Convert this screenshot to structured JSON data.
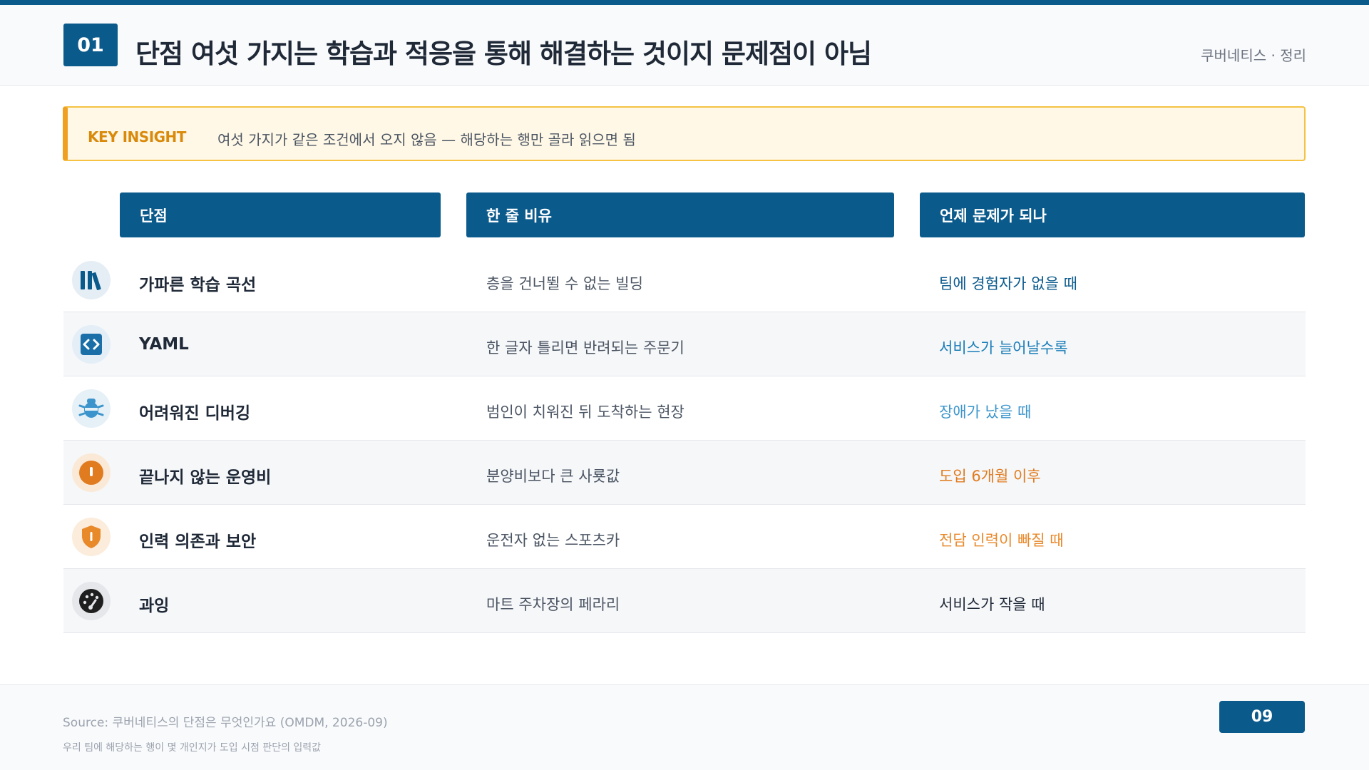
{
  "header": {
    "badge": "01",
    "title": "단점 여섯 가지는 학습과 적응을 통해 해결하는 것이지 문제점이 아님",
    "tag": "쿠버네티스 · 정리"
  },
  "insight": {
    "label": "KEY INSIGHT",
    "text": "여섯 가지가 같은 조건에서 오지 않음 — 해당하는 행만 골라 읽으면 됨"
  },
  "table": {
    "headers": [
      "단점",
      "한 줄 비유",
      "언제 문제가 되나"
    ],
    "rows": [
      {
        "icon": "books-icon",
        "name": "가파른 학습 곡선",
        "metaphor": "층을 건너뛸 수 없는 빌딩",
        "when": "팀에 경험자가 없을 때",
        "color": "#0b5a8c"
      },
      {
        "icon": "code-icon",
        "name": "YAML",
        "metaphor": "한 글자 틀리면 반려되는 주문기",
        "when": "서비스가 늘어날수록",
        "color": "#1a7db8"
      },
      {
        "icon": "bug-icon",
        "name": "어려워진 디버깅",
        "metaphor": "범인이 치워진 뒤 도착하는 현장",
        "when": "장애가 났을 때",
        "color": "#3b95cc"
      },
      {
        "icon": "alert-icon",
        "name": "끝나지 않는 운영비",
        "metaphor": "분양비보다 큰 사룟값",
        "when": "도입 6개월 이후",
        "color": "#e07b1f"
      },
      {
        "icon": "shield-icon",
        "name": "인력 의존과 보안",
        "metaphor": "운전자 없는 스포츠카",
        "when": "전담 인력이 빠질 때",
        "color": "#e8892a"
      },
      {
        "icon": "gauge-icon",
        "name": "과잉",
        "metaphor": "마트 주차장의 페라리",
        "when": "서비스가 작을 때",
        "color": "#1f2937"
      }
    ]
  },
  "footer": {
    "source": "Source: 쿠버네티스의 단점은 무엇인가요 (OMDM, 2026-09)",
    "note": "우리 팀에 해당하는 행이 몇 개인지가 도입 시점 판단의 입력값",
    "page": "09"
  }
}
